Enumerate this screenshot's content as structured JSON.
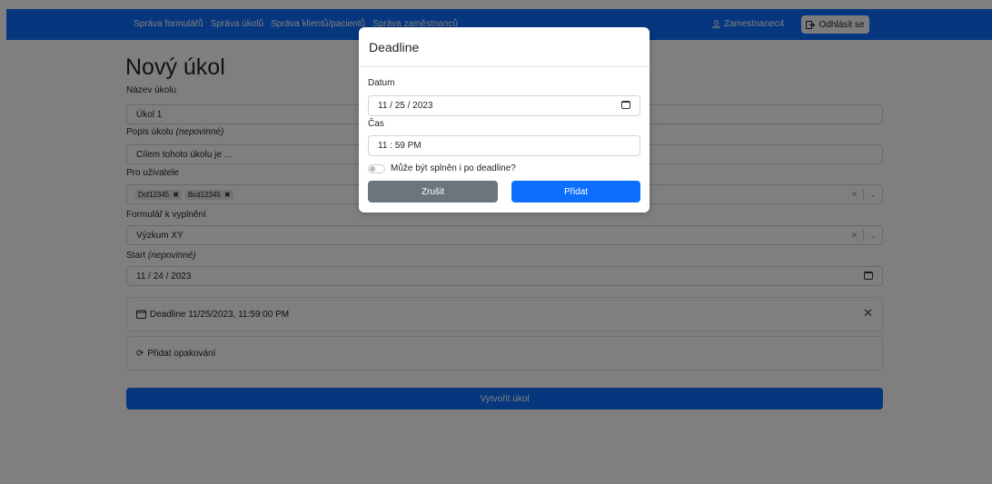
{
  "navbar": {
    "links": [
      "Správa formulářů",
      "Správa úkolů",
      "Správa klientů/pacientů",
      "Správa zaměstnanců"
    ],
    "user": "Zamestnanec4",
    "logout": "Odhlásit se"
  },
  "form": {
    "title": "Nový úkol",
    "name_label": "Název úkolu",
    "name_value": "Úkol 1",
    "desc_label": "Popis úkolu",
    "desc_optional": "(nepovinné)",
    "desc_value": "Cílem tohoto úkolu je ...",
    "users_label": "Pro uživatele",
    "users": [
      "Dcf12345",
      "Bcd12345"
    ],
    "form_label": "Formulář k vyplnění",
    "form_value": "Výzkum XY",
    "start_label": "Start",
    "start_optional": "(nepovinné)",
    "start_value": "11 / 24 / 2023",
    "deadline_text": "Deadline 11/25/2023, 11:59:00 PM",
    "repeat_text": "Přidat opakování",
    "submit": "Vytvořit úkol"
  },
  "modal": {
    "title": "Deadline",
    "date_label": "Datum",
    "date_value": "11 / 25 / 2023",
    "time_label": "Čas",
    "time_value": "11 : 59  PM",
    "toggle_label": "Může být splněn i po deadline?",
    "cancel": "Zrušit",
    "add": "Přidat"
  }
}
